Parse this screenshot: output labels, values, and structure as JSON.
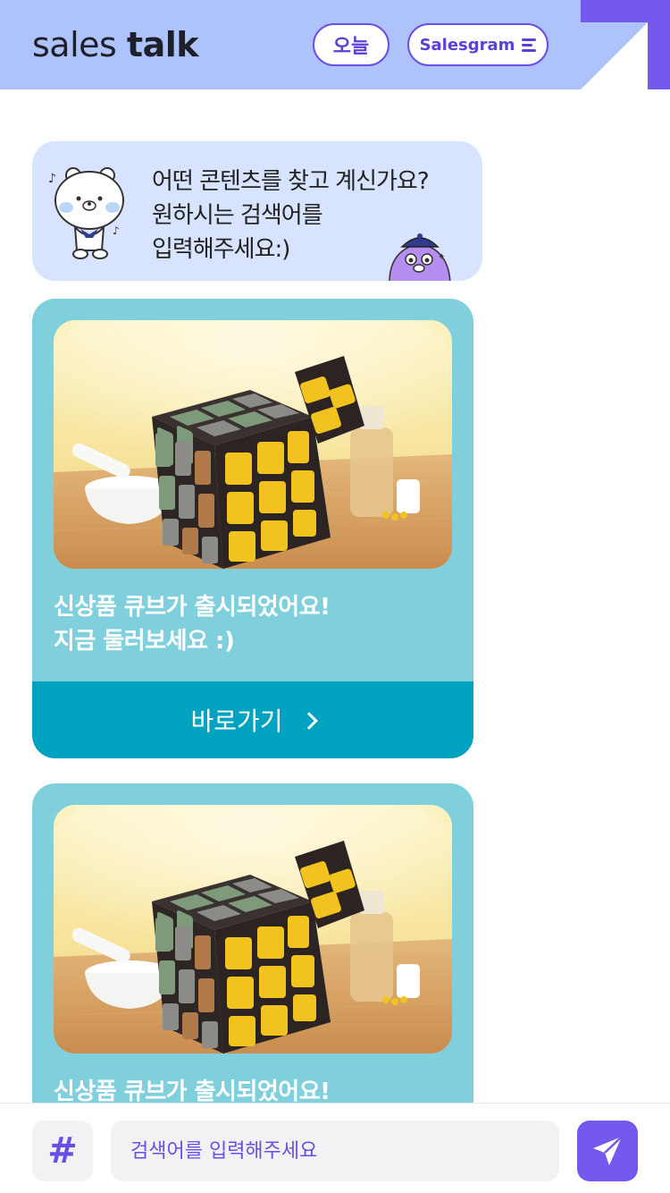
{
  "header": {
    "logo_light": "sales ",
    "logo_bold": "talk",
    "today_label": "오늘",
    "salesgram_label": "Salesgram",
    "menu_icon": "menu-lines-icon",
    "accent_color": "#6a4fe4",
    "header_color": "#aec3fb"
  },
  "bot_message": {
    "lines": [
      "어떤 콘텐츠를 찾고 계신가요?",
      "원하시는 검색어를",
      "입력해주세요:)"
    ],
    "bubble_color": "#d8e3ff"
  },
  "cards": [
    {
      "title_lines": [
        "신상품 큐브가 출시되었어요!",
        "지금 둘러보세요 :)"
      ],
      "button_label": "바로가기",
      "image": "rubiks-cube-product-image"
    },
    {
      "title_lines": [
        "신상품 큐브가 출시되었어요!"
      ],
      "image": "rubiks-cube-product-image"
    }
  ],
  "bottom_bar": {
    "hash_label": "#",
    "search_placeholder": "검색어를 입력해주세요",
    "send_icon": "paper-plane-icon"
  }
}
